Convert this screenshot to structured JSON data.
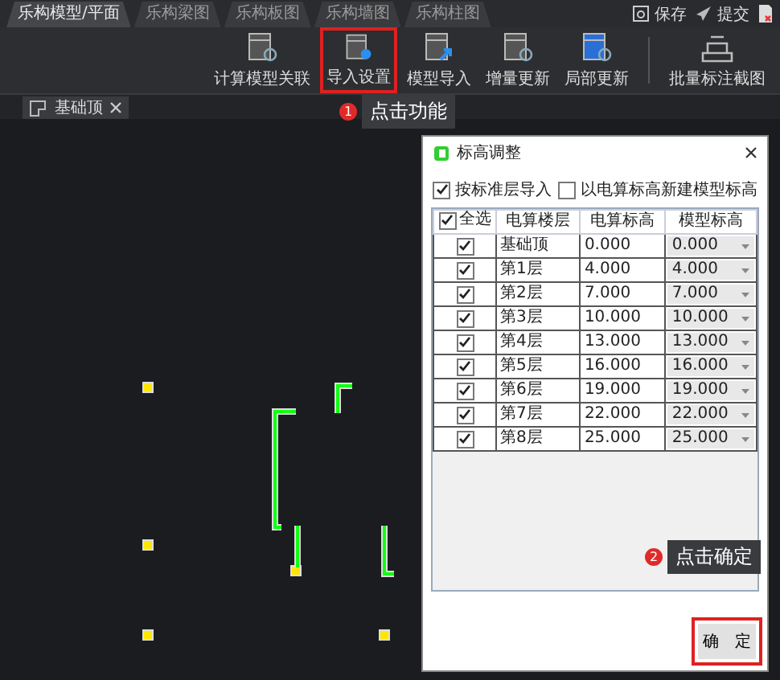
{
  "module_tabs": [
    {
      "label": "乐构模型/平面",
      "selected": true
    },
    {
      "label": "乐构梁图",
      "selected": false
    },
    {
      "label": "乐构板图",
      "selected": false
    },
    {
      "label": "乐构墙图",
      "selected": false
    },
    {
      "label": "乐构柱图",
      "selected": false
    }
  ],
  "top_actions": [
    {
      "label": "保存",
      "kind": "save"
    },
    {
      "label": "提交",
      "kind": "submit"
    }
  ],
  "toolbar": [
    {
      "label": "计算模型关联",
      "kind": "link",
      "highlighted": false
    },
    {
      "label": "导入设置",
      "kind": "settings",
      "highlighted": true,
      "callout": {
        "number": "1",
        "text": "点击功能"
      }
    },
    {
      "label": "模型导入",
      "kind": "import",
      "highlighted": false
    },
    {
      "label": "增量更新",
      "kind": "refresh",
      "highlighted": false
    },
    {
      "label": "局部更新",
      "kind": "partial",
      "highlighted": false
    },
    {
      "label": "批量标注截图",
      "kind": "batch",
      "highlighted": false
    }
  ],
  "doc_tab": {
    "label": "基础顶"
  },
  "dialog": {
    "title": "标高调整",
    "options": [
      {
        "label": "按标准层导入",
        "checked": true
      },
      {
        "label": "以电算标高新建模型标高",
        "checked": false
      }
    ],
    "select_all": {
      "label": "全选",
      "checked": true
    },
    "columns": [
      "电算楼层",
      "电算标高",
      "模型标高"
    ],
    "rows": [
      {
        "checked": true,
        "floor": "基础顶",
        "elevation": "0.000",
        "model_elevation": "0.000"
      },
      {
        "checked": true,
        "floor": "第1层",
        "elevation": "4.000",
        "model_elevation": "4.000"
      },
      {
        "checked": true,
        "floor": "第2层",
        "elevation": "7.000",
        "model_elevation": "7.000"
      },
      {
        "checked": true,
        "floor": "第3层",
        "elevation": "10.000",
        "model_elevation": "10.000"
      },
      {
        "checked": true,
        "floor": "第4层",
        "elevation": "13.000",
        "model_elevation": "13.000"
      },
      {
        "checked": true,
        "floor": "第5层",
        "elevation": "16.000",
        "model_elevation": "16.000"
      },
      {
        "checked": true,
        "floor": "第6层",
        "elevation": "19.000",
        "model_elevation": "19.000"
      },
      {
        "checked": true,
        "floor": "第7层",
        "elevation": "22.000",
        "model_elevation": "22.000"
      },
      {
        "checked": true,
        "floor": "第8层",
        "elevation": "25.000",
        "model_elevation": "25.000"
      }
    ],
    "confirm": {
      "label": "确　定",
      "highlighted": true,
      "callout": {
        "number": "2",
        "text": "点击确定"
      }
    }
  }
}
